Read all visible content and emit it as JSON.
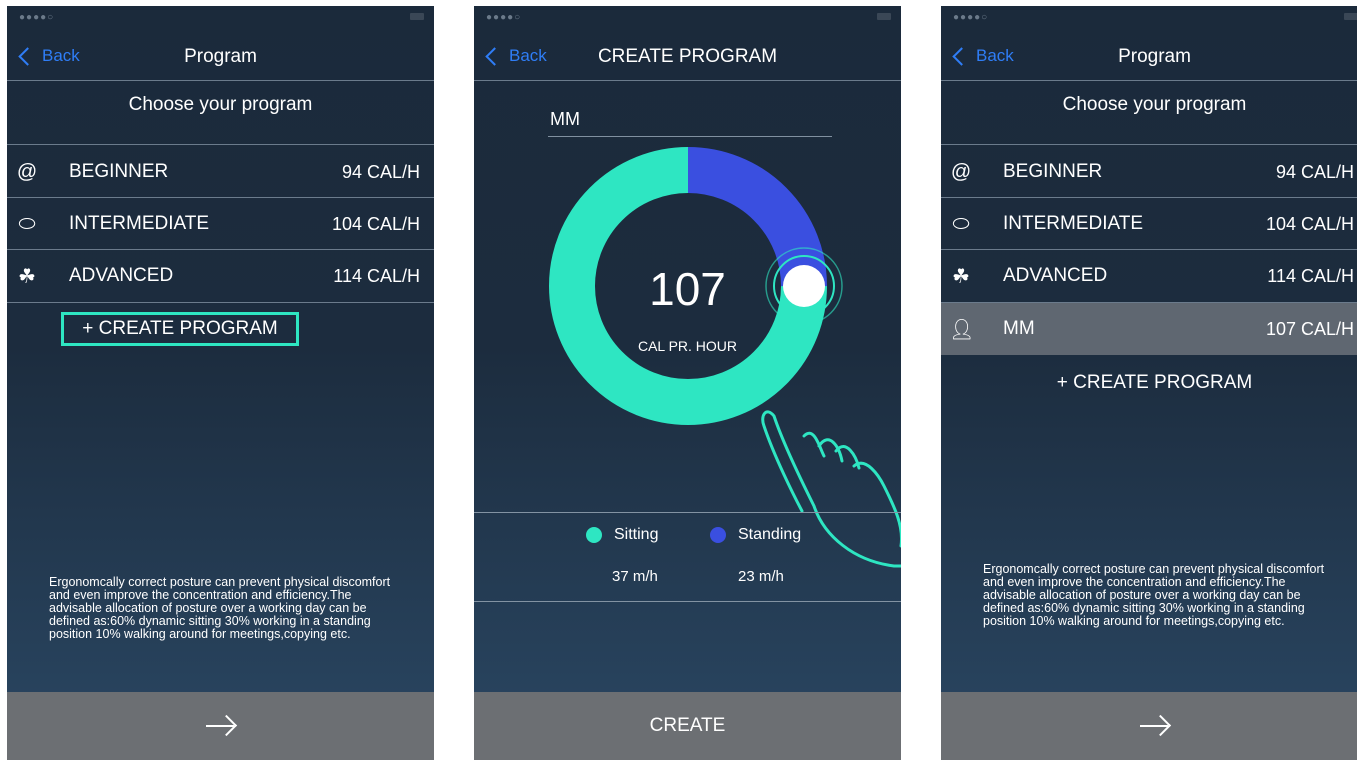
{
  "colors": {
    "accent": "#2ee6c2",
    "sitting": "#2ee6c2",
    "standing": "#3a4fe0",
    "back": "#2f7df6",
    "selected_row": "#5f6771",
    "bottom_bar": "#6c6f73"
  },
  "screen1": {
    "nav": {
      "back_label": "Back",
      "title": "Program"
    },
    "subtitle": "Choose your program",
    "programs": [
      {
        "icon": "snail-icon",
        "name": "BEGINNER",
        "cal": "94 CAL/H"
      },
      {
        "icon": "turtle-icon",
        "name": "INTERMEDIATE",
        "cal": "104 CAL/H"
      },
      {
        "icon": "rabbit-icon",
        "name": "ADVANCED",
        "cal": "114 CAL/H"
      }
    ],
    "create_label": "+ CREATE PROGRAM",
    "info": "Ergonomcally correct posture can prevent physical discomfort and even improve the concentration and efficiency.The advisable allocation of posture over a working day can be defined as:60% dynamic sitting 30% working in a standing position 10% walking around for meetings,copying etc."
  },
  "screen2": {
    "nav": {
      "back_label": "Back",
      "title": "CREATE PROGRAM"
    },
    "name_value": "MM",
    "calories": "107",
    "calories_unit": "CAL PR. HOUR",
    "sitting_fraction": 0.75,
    "legend": [
      {
        "label": "Sitting",
        "value": "37 m/h"
      },
      {
        "label": "Standing",
        "value": "23 m/h"
      }
    ],
    "create_button": "CREATE"
  },
  "screen3": {
    "nav": {
      "back_label": "Back",
      "title": "Program"
    },
    "subtitle": "Choose your program",
    "programs": [
      {
        "icon": "snail-icon",
        "name": "BEGINNER",
        "cal": "94 CAL/H"
      },
      {
        "icon": "turtle-icon",
        "name": "INTERMEDIATE",
        "cal": "104 CAL/H"
      },
      {
        "icon": "rabbit-icon",
        "name": "ADVANCED",
        "cal": "114 CAL/H"
      },
      {
        "icon": "person-icon",
        "name": "MM",
        "cal": "107 CAL/H"
      }
    ],
    "create_label": "+ CREATE PROGRAM",
    "info": "Ergonomcally correct posture can prevent physical discomfort and even improve the concentration and efficiency.The advisable allocation of posture over a working day can be defined as:60% dynamic sitting 30% working in a standing position 10% walking around for meetings,copying etc."
  }
}
